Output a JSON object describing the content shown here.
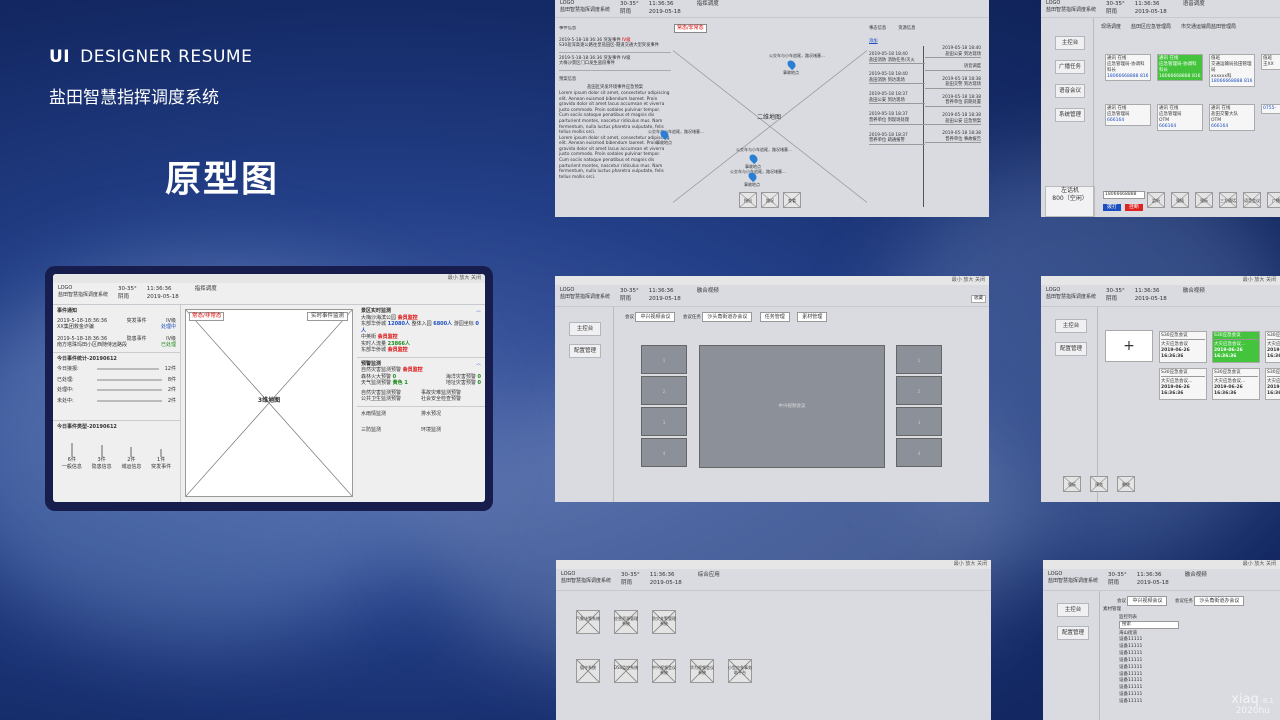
{
  "header": {
    "ui": "UI",
    "title": "DESIGNER RESUME",
    "project": "盐田智慧指挥调度系统",
    "section": "原型图"
  },
  "common": {
    "logo": "LOGO",
    "system": "盐田智慧指挥调度系统",
    "temp": "30-35°",
    "weather": "阴雨",
    "time": "11:36:36",
    "date": "2019-05-18",
    "win_min": "最小",
    "win_max": "放大",
    "win_close": "关闭"
  },
  "tabs": {
    "dispatch": "指挥调度",
    "voice": "语音调度",
    "fusion": "融合视频",
    "integrated": "综合应用"
  },
  "featured": {
    "event_title": "事件通知",
    "events": [
      {
        "time": "2019-5-18-18:36:36",
        "type": "突发事件",
        "level": "IV级",
        "desc": "XX集团救金诈骗",
        "status": "处理中"
      },
      {
        "time": "2019-5-18-18:36:36",
        "type": "隐患事件",
        "level": "IV级",
        "desc": "南方塔珠玛田小区西随侍远路段",
        "status": "已处理"
      }
    ],
    "stats_title": "今日事件统计-20190612",
    "stats": [
      {
        "label": "今日接报:",
        "value": "12件"
      },
      {
        "label": "已处理:",
        "value": "8件"
      },
      {
        "label": "处理中:",
        "value": "2件"
      },
      {
        "label": "未处中:",
        "value": "2件"
      }
    ],
    "types_title": "今日事件类型-20190612",
    "types": [
      {
        "count": "6件",
        "name": "一般信息"
      },
      {
        "count": "3件",
        "name": "隐患信息"
      },
      {
        "count": "2件",
        "name": "城运信息"
      },
      {
        "count": "1件",
        "name": "突发事件"
      }
    ],
    "map_toggle": "常态/非常态",
    "map_select": "实时事件监测",
    "map_label": "3维地图",
    "scenic_title": "景区实时监测",
    "scenic": [
      {
        "label": "大梅沙海滨公园",
        "value": "会员监控"
      },
      {
        "label": "东部华侨城",
        "value": "12080人",
        "extra": "整体入园",
        "extra_val": "6800人",
        "extra2": "游园坐标",
        "extra2_val": "0人"
      },
      {
        "label": "中英街",
        "value": "会员监控"
      },
      {
        "label": "实时人流量",
        "value": "23866人"
      },
      {
        "label": "东部华侨城",
        "value": "会员监控"
      }
    ],
    "warn_title": "预警监测",
    "warns": [
      {
        "label": "自然灾害监测预警",
        "value": "会员监控"
      },
      {
        "label": "森林火大预警",
        "value": "0",
        "label2": "海洋灾害预警",
        "value2": "0"
      },
      {
        "label": "天气监测预警",
        "value": "黄色 1",
        "label2": "地址灾害预警",
        "value2": "0"
      }
    ],
    "extra_rows": [
      "自然灾害监测预警",
      "事故灾难监测预警",
      "公共卫生监测预警",
      "社会安全检查预警"
    ],
    "water": "水雨情监测",
    "pump": "排水预况",
    "sanfang": "三防监测",
    "env": "环境监测"
  },
  "shot1": {
    "event_title": "事件信息",
    "toggle": "常态/非常态",
    "map": "二维地图",
    "events": [
      {
        "time": "2019-5-18-18:36:36",
        "type": "突发事件",
        "level": "IV级",
        "desc": "S30盐深高速公路往皇盐田区-隧道交通大型突发事件"
      },
      {
        "time": "2019-5-18-18:36:36",
        "type": "突发事件",
        "level": "IV级",
        "desc": "大梅沙景区门口发生盗窃事件"
      }
    ],
    "plan_title": "预案信息",
    "plan_name": "盐田区突发环境事件应急预案",
    "lorem": "Lorem ipsum dolor sit amet, consectetur adipiscing elit. Aenean euismod bibendum laoreet. Proin gravida dolor sit amet lacus accumsan et viverra justo commodo. Proin sodales pulvinar tempor. Cum sociis natoque penatibus et magnis dis parturient montes, nascetur ridiculus mus. Nam fermentum, nulla luctus pharetra vulputate, felis tellus mollis orci.",
    "pins": [
      "公交车与小车追尾，路况堵塞...",
      "公交车与小车追尾，路况堵塞...",
      "公交车与小车追尾，路况堵塞...",
      "公交车与小车追尾，路况堵塞..."
    ],
    "pin_label": "事故地点",
    "map_btns": [
      "指出",
      "路况",
      "查看"
    ],
    "right_tabs": [
      "事态信息",
      "资源信息"
    ],
    "add": "添加",
    "timeline": [
      {
        "time": "2019-05-18 18:40",
        "l1": "盐田消防",
        "l2": "消防任务/灭火"
      },
      {
        "time": "2019-05-18 18:40",
        "l1": "盐田消防",
        "l2": "到达现场"
      },
      {
        "time": "2019-05-18 18:37",
        "l1": "盐田公安",
        "l2": "到达现场"
      },
      {
        "time": "2019-05-18 18:37",
        "l1": "普养单位",
        "l2": "到现场处理"
      },
      {
        "time": "2019-05-18 18:37",
        "l1": "普养单位",
        "l2": "疏通报警"
      }
    ],
    "timeline_r": [
      {
        "time": "2019-05-18 18:40",
        "l1": "盐田公安",
        "l2": "到达现场"
      },
      {
        "time": "",
        "l1": "语音调度",
        "l2": ""
      },
      {
        "time": "2019-05-18 18:38",
        "l1": "盐田交警",
        "l2": "到达现场"
      },
      {
        "time": "2019-05-18 18:38",
        "l1": "普养单位",
        "l2": "前期处置"
      },
      {
        "time": "2019-05-18 18:38",
        "l1": "盐田公安",
        "l2": "应急预案"
      },
      {
        "time": "2019-05-18 18:38",
        "l1": "普养单位",
        "l2": "事故报告"
      }
    ]
  },
  "shot2": {
    "side": [
      "主控台",
      "广播任务",
      "语音会议",
      "系统管理"
    ],
    "tabs": [
      "现场调度",
      "盐田区应急管理局",
      "市交通运输局盐田管理局"
    ],
    "cards_top": [
      {
        "tag": "通讯",
        "st": "在线",
        "name": "应急管理局-协调科",
        "role": "科长",
        "num": "18066668888",
        "ext": "816",
        "g": false
      },
      {
        "tag": "通讯",
        "st": "在线",
        "name": "应急管理局-协调科",
        "role": "科长",
        "num": "18066668888",
        "ext": "816",
        "g": true
      },
      {
        "tag": "值班",
        "st": "",
        "name": "交通运输局盐田管理局",
        "role": "xxxxxx科",
        "num": "18066668888",
        "ext": "816",
        "g": false
      },
      {
        "tag": "值班",
        "st": "",
        "name": "",
        "role": "王XX",
        "num": "",
        "ext": "",
        "g": false
      }
    ],
    "cards_bot": [
      {
        "tag": "通讯",
        "st": "在线",
        "name": "应急管理局",
        "role": "",
        "num": "666164",
        "ext": "",
        "g": false
      },
      {
        "tag": "通讯",
        "st": "在线",
        "name": "应急管理局",
        "role": "OTM",
        "num": "666164",
        "ext": "",
        "g": false
      },
      {
        "tag": "通讯",
        "st": "在线",
        "name": "盐田交警大队",
        "role": "OTM",
        "num": "666164",
        "ext": "",
        "g": false
      },
      {
        "tag": "",
        "st": "",
        "name": "",
        "role": "",
        "num": "0755-",
        "ext": "",
        "g": false
      }
    ],
    "line_label": "左话机",
    "line_num": "800（空闲）",
    "phone": "18066668888",
    "dial": "拨打",
    "hang": "挂断",
    "bottom": [
      "监听",
      "强插",
      "强拆",
      "三方通话",
      "语音会议",
      "广播"
    ]
  },
  "shot3": {
    "side": [
      "主控台",
      "配置管理"
    ],
    "filters": [
      "会议",
      "中兴视频会议",
      "会议任务",
      "沙头角街道办会议",
      "任务管理",
      "素材管理"
    ],
    "fav": "收藏",
    "center": "中兴视频会议"
  },
  "shot4": {
    "side": [
      "主控台",
      "配置管理"
    ],
    "cards": [
      {
        "title": "S30应急会议",
        "name": "大灾应急会议",
        "time": "2019-06-26 16:36:36",
        "g": false
      },
      {
        "title": "S30应急会议",
        "name": "大灾应急会议...",
        "time": "2019-06-26 16:36:36",
        "g": true
      },
      {
        "title": "S30应急会议",
        "name": "大灾应急会议...",
        "time": "2019-06-26 16:36:36",
        "g": false
      },
      {
        "title": "S30应急会议",
        "name": "大灾应急会议...",
        "time": "2019-06-26 16:36:36",
        "g": false
      },
      {
        "title": "S30应急会议",
        "name": "大灾应急会议...",
        "time": "2019-06-26 16:36:36",
        "g": false
      },
      {
        "title": "S30应急会议",
        "name": "大灾应急会议...",
        "time": "2019-06-26 16:36:36",
        "g": false
      }
    ],
    "add": "+",
    "btns": [
      "强拆",
      "预览",
      "删除"
    ]
  },
  "shot5": {
    "apps": [
      "气象决策系统",
      "应急资源管理系统",
      "防灾关警管理系统",
      "值守系统",
      "DSS监控系统",
      "中兴视频会议系统",
      "华为视频会议系统",
      "小型应急事务助平台"
    ]
  },
  "shot6": {
    "side": [
      "主控台",
      "配置管理"
    ],
    "filters": [
      "会议",
      "中兴视频会议",
      "会议任务",
      "沙头角街道办会议"
    ],
    "list_title": "素材管理",
    "sub": "监控列表",
    "search": "搜索",
    "group": "海山街道",
    "devices": [
      "设备11111",
      "设备11111",
      "设备11111",
      "设备11111",
      "设备11111",
      "设备11111",
      "设备11111",
      "设备11111",
      "设备11111",
      "设备11111"
    ],
    "wm1": "xiaq",
    "wm_v": "8.1",
    "wm2": "2020hu"
  }
}
